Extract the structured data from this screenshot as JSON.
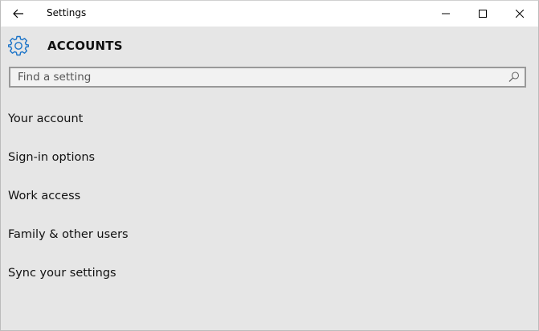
{
  "titlebar": {
    "app_title": "Settings",
    "back_icon": "arrow-left-icon",
    "minimize_icon": "minimize-icon",
    "maximize_icon": "maximize-icon",
    "close_icon": "close-icon"
  },
  "header": {
    "icon": "gear-icon",
    "title": "ACCOUNTS",
    "accent_color": "#1a73c8"
  },
  "search": {
    "placeholder": "Find a setting",
    "value": "",
    "icon": "search-icon"
  },
  "menu": {
    "items": [
      {
        "label": "Your account"
      },
      {
        "label": "Sign-in options"
      },
      {
        "label": "Work access"
      },
      {
        "label": "Family & other users"
      },
      {
        "label": "Sync your settings"
      }
    ]
  }
}
